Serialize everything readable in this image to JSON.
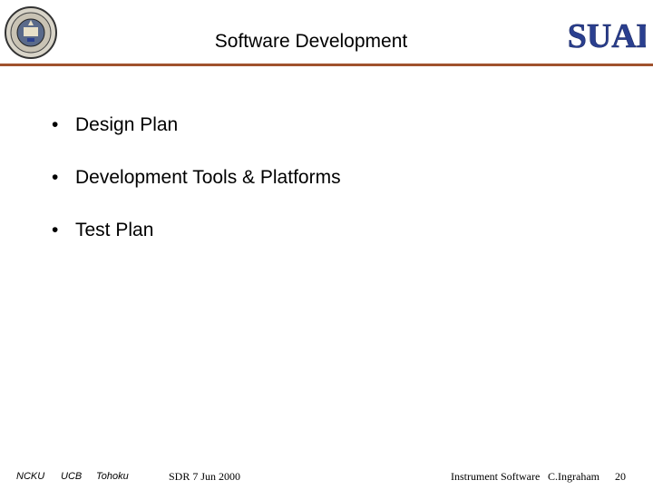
{
  "header": {
    "title": "Software Development",
    "seal_icon": "university-seal-icon",
    "logo_text": "ISUAL",
    "rule_color": "#a0522d",
    "logo_color": "#2a3f8f"
  },
  "bullets": [
    {
      "symbol": "•",
      "text": "Design Plan"
    },
    {
      "symbol": "•",
      "text": "Development Tools & Platforms"
    },
    {
      "symbol": "•",
      "text": "Test Plan"
    }
  ],
  "footer": {
    "org1": "NCKU",
    "org2": "UCB",
    "org3": "Tohoku",
    "date": "SDR 7 Jun 2000",
    "subject": "Instrument Software",
    "author": "C.Ingraham",
    "page": "20"
  }
}
